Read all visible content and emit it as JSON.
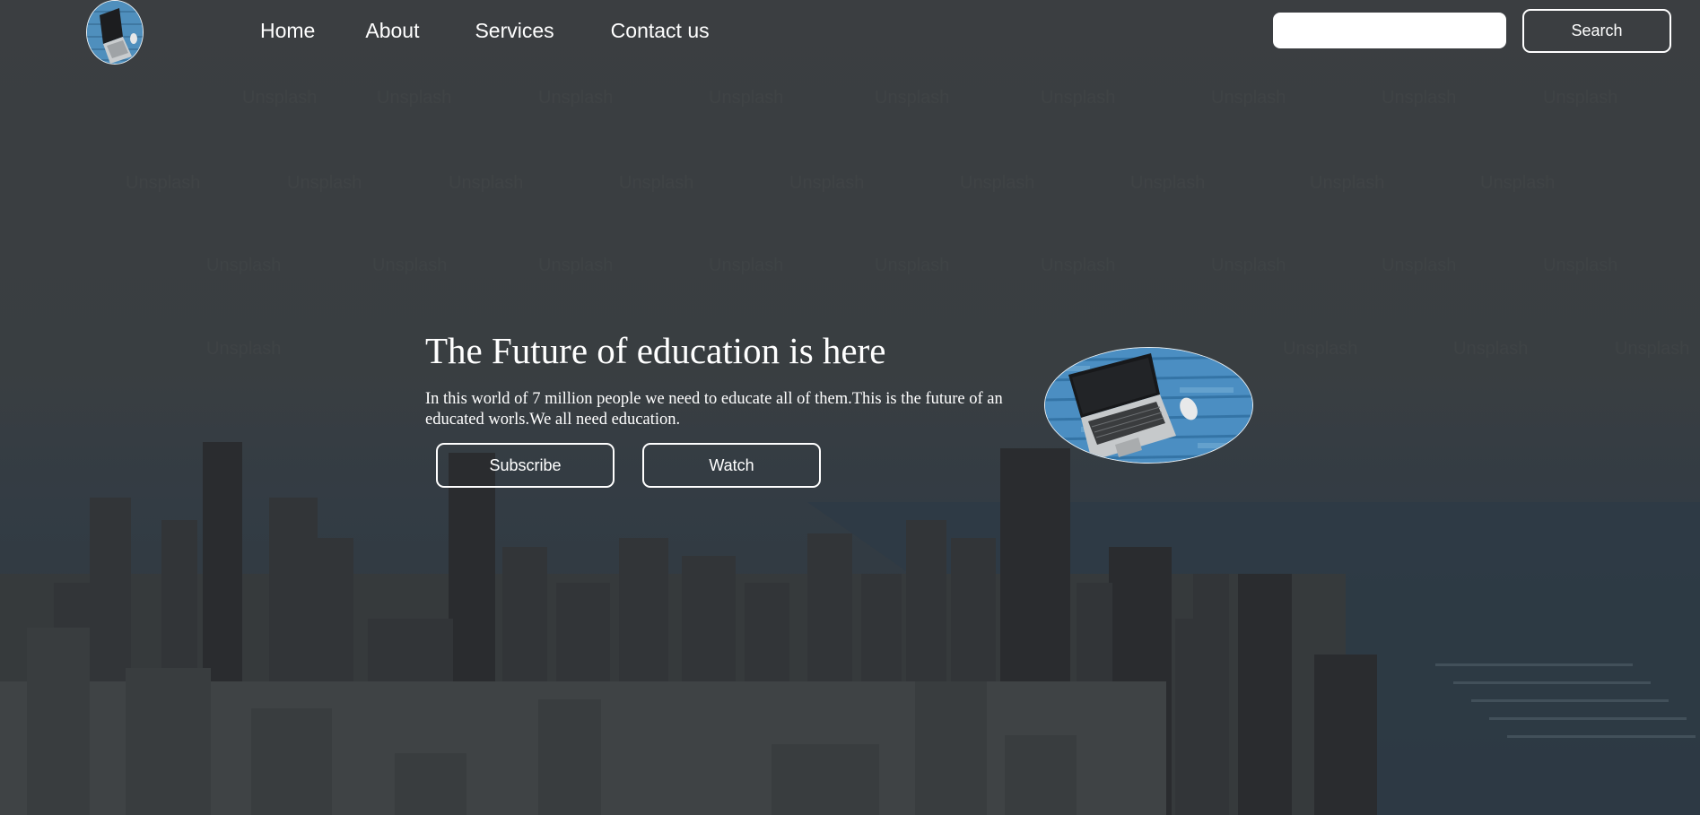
{
  "header": {
    "logo_icon": "laptop-logo-icon",
    "nav": [
      {
        "label": "Home"
      },
      {
        "label": "About"
      },
      {
        "label": "Services"
      },
      {
        "label": "Contact us"
      }
    ],
    "search": {
      "value": "",
      "placeholder": "",
      "button_label": "Search"
    }
  },
  "hero": {
    "title": "The Future of education is here",
    "text": "In this world of 7 million people we need to educate all of them.This is the future of an educated worls.We all need education.",
    "buttons": {
      "subscribe_label": "Subscribe",
      "watch_label": "Watch"
    },
    "image_icon": "laptop-image"
  },
  "background": {
    "image": "city-skyline-photo",
    "overlay_color": "#3c3f42"
  }
}
